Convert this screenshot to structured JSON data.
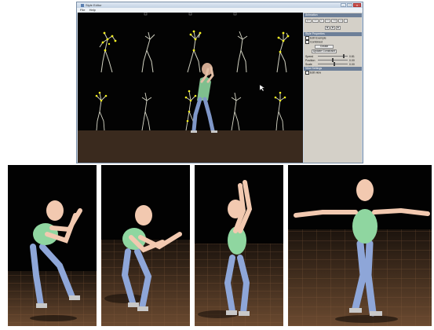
{
  "window": {
    "title": "Style Editor",
    "menu": [
      "File",
      "Help"
    ],
    "controls": {
      "minimize": "–",
      "maximize": "□",
      "close": "x"
    }
  },
  "panel": {
    "animation_header": "Animation",
    "playback_buttons": [
      "|<<",
      "<<",
      ">",
      ">>",
      ">>|",
      "+",
      "-"
    ],
    "mode_buttons": [
      "■",
      "■",
      "■"
    ],
    "style_header": "Style Properties",
    "edit_label": "Edit Example",
    "combined_label": "Combined",
    "create_button": "Create",
    "update_button": "Update Constraint",
    "sliders": [
      {
        "label": "Speed",
        "value": "0.81",
        "level": 0.88
      },
      {
        "label": "Position",
        "value": "0.00",
        "level": 0.5
      },
      {
        "label": "Scale",
        "value": "0.00",
        "level": 0.55
      }
    ],
    "view_header": "View Settings",
    "show_label": "Edit view"
  },
  "colors": {
    "window_bg": "#c8d6e6",
    "viewport_bg": "#030303",
    "skeleton": "#d8d8c0",
    "joint": "#f4f020",
    "body_torso": "#8fd6a0",
    "body_limbs": "#8ea6d8",
    "body_skin": "#f2c9b0",
    "floor": "#5a3f2a"
  }
}
